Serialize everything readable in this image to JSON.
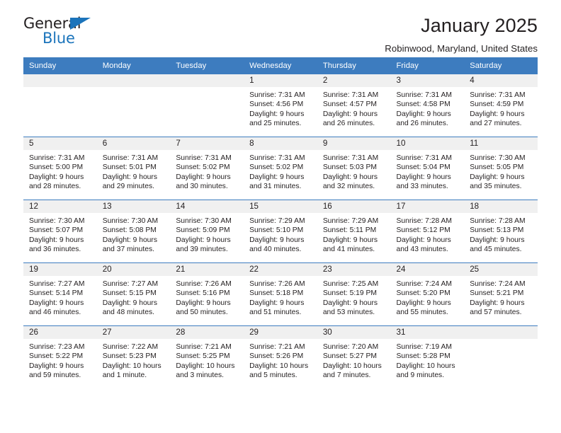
{
  "brand": {
    "name_part1": "General",
    "name_part2": "Blue",
    "triangle_color": "#1b74bb"
  },
  "header": {
    "month_title": "January 2025",
    "location": "Robinwood, Maryland, United States"
  },
  "theme": {
    "header_blue": "#3d7cbf",
    "daynum_bg": "#f0f0f0",
    "text": "#231f20"
  },
  "calendar": {
    "weekday_headers": [
      "Sunday",
      "Monday",
      "Tuesday",
      "Wednesday",
      "Thursday",
      "Friday",
      "Saturday"
    ],
    "weeks": [
      [
        {
          "day": "",
          "sunrise": "",
          "sunset": "",
          "daylight_line1": "",
          "daylight_line2": ""
        },
        {
          "day": "",
          "sunrise": "",
          "sunset": "",
          "daylight_line1": "",
          "daylight_line2": ""
        },
        {
          "day": "",
          "sunrise": "",
          "sunset": "",
          "daylight_line1": "",
          "daylight_line2": ""
        },
        {
          "day": "1",
          "sunrise": "Sunrise: 7:31 AM",
          "sunset": "Sunset: 4:56 PM",
          "daylight_line1": "Daylight: 9 hours",
          "daylight_line2": "and 25 minutes."
        },
        {
          "day": "2",
          "sunrise": "Sunrise: 7:31 AM",
          "sunset": "Sunset: 4:57 PM",
          "daylight_line1": "Daylight: 9 hours",
          "daylight_line2": "and 26 minutes."
        },
        {
          "day": "3",
          "sunrise": "Sunrise: 7:31 AM",
          "sunset": "Sunset: 4:58 PM",
          "daylight_line1": "Daylight: 9 hours",
          "daylight_line2": "and 26 minutes."
        },
        {
          "day": "4",
          "sunrise": "Sunrise: 7:31 AM",
          "sunset": "Sunset: 4:59 PM",
          "daylight_line1": "Daylight: 9 hours",
          "daylight_line2": "and 27 minutes."
        }
      ],
      [
        {
          "day": "5",
          "sunrise": "Sunrise: 7:31 AM",
          "sunset": "Sunset: 5:00 PM",
          "daylight_line1": "Daylight: 9 hours",
          "daylight_line2": "and 28 minutes."
        },
        {
          "day": "6",
          "sunrise": "Sunrise: 7:31 AM",
          "sunset": "Sunset: 5:01 PM",
          "daylight_line1": "Daylight: 9 hours",
          "daylight_line2": "and 29 minutes."
        },
        {
          "day": "7",
          "sunrise": "Sunrise: 7:31 AM",
          "sunset": "Sunset: 5:02 PM",
          "daylight_line1": "Daylight: 9 hours",
          "daylight_line2": "and 30 minutes."
        },
        {
          "day": "8",
          "sunrise": "Sunrise: 7:31 AM",
          "sunset": "Sunset: 5:02 PM",
          "daylight_line1": "Daylight: 9 hours",
          "daylight_line2": "and 31 minutes."
        },
        {
          "day": "9",
          "sunrise": "Sunrise: 7:31 AM",
          "sunset": "Sunset: 5:03 PM",
          "daylight_line1": "Daylight: 9 hours",
          "daylight_line2": "and 32 minutes."
        },
        {
          "day": "10",
          "sunrise": "Sunrise: 7:31 AM",
          "sunset": "Sunset: 5:04 PM",
          "daylight_line1": "Daylight: 9 hours",
          "daylight_line2": "and 33 minutes."
        },
        {
          "day": "11",
          "sunrise": "Sunrise: 7:30 AM",
          "sunset": "Sunset: 5:05 PM",
          "daylight_line1": "Daylight: 9 hours",
          "daylight_line2": "and 35 minutes."
        }
      ],
      [
        {
          "day": "12",
          "sunrise": "Sunrise: 7:30 AM",
          "sunset": "Sunset: 5:07 PM",
          "daylight_line1": "Daylight: 9 hours",
          "daylight_line2": "and 36 minutes."
        },
        {
          "day": "13",
          "sunrise": "Sunrise: 7:30 AM",
          "sunset": "Sunset: 5:08 PM",
          "daylight_line1": "Daylight: 9 hours",
          "daylight_line2": "and 37 minutes."
        },
        {
          "day": "14",
          "sunrise": "Sunrise: 7:30 AM",
          "sunset": "Sunset: 5:09 PM",
          "daylight_line1": "Daylight: 9 hours",
          "daylight_line2": "and 39 minutes."
        },
        {
          "day": "15",
          "sunrise": "Sunrise: 7:29 AM",
          "sunset": "Sunset: 5:10 PM",
          "daylight_line1": "Daylight: 9 hours",
          "daylight_line2": "and 40 minutes."
        },
        {
          "day": "16",
          "sunrise": "Sunrise: 7:29 AM",
          "sunset": "Sunset: 5:11 PM",
          "daylight_line1": "Daylight: 9 hours",
          "daylight_line2": "and 41 minutes."
        },
        {
          "day": "17",
          "sunrise": "Sunrise: 7:28 AM",
          "sunset": "Sunset: 5:12 PM",
          "daylight_line1": "Daylight: 9 hours",
          "daylight_line2": "and 43 minutes."
        },
        {
          "day": "18",
          "sunrise": "Sunrise: 7:28 AM",
          "sunset": "Sunset: 5:13 PM",
          "daylight_line1": "Daylight: 9 hours",
          "daylight_line2": "and 45 minutes."
        }
      ],
      [
        {
          "day": "19",
          "sunrise": "Sunrise: 7:27 AM",
          "sunset": "Sunset: 5:14 PM",
          "daylight_line1": "Daylight: 9 hours",
          "daylight_line2": "and 46 minutes."
        },
        {
          "day": "20",
          "sunrise": "Sunrise: 7:27 AM",
          "sunset": "Sunset: 5:15 PM",
          "daylight_line1": "Daylight: 9 hours",
          "daylight_line2": "and 48 minutes."
        },
        {
          "day": "21",
          "sunrise": "Sunrise: 7:26 AM",
          "sunset": "Sunset: 5:16 PM",
          "daylight_line1": "Daylight: 9 hours",
          "daylight_line2": "and 50 minutes."
        },
        {
          "day": "22",
          "sunrise": "Sunrise: 7:26 AM",
          "sunset": "Sunset: 5:18 PM",
          "daylight_line1": "Daylight: 9 hours",
          "daylight_line2": "and 51 minutes."
        },
        {
          "day": "23",
          "sunrise": "Sunrise: 7:25 AM",
          "sunset": "Sunset: 5:19 PM",
          "daylight_line1": "Daylight: 9 hours",
          "daylight_line2": "and 53 minutes."
        },
        {
          "day": "24",
          "sunrise": "Sunrise: 7:24 AM",
          "sunset": "Sunset: 5:20 PM",
          "daylight_line1": "Daylight: 9 hours",
          "daylight_line2": "and 55 minutes."
        },
        {
          "day": "25",
          "sunrise": "Sunrise: 7:24 AM",
          "sunset": "Sunset: 5:21 PM",
          "daylight_line1": "Daylight: 9 hours",
          "daylight_line2": "and 57 minutes."
        }
      ],
      [
        {
          "day": "26",
          "sunrise": "Sunrise: 7:23 AM",
          "sunset": "Sunset: 5:22 PM",
          "daylight_line1": "Daylight: 9 hours",
          "daylight_line2": "and 59 minutes."
        },
        {
          "day": "27",
          "sunrise": "Sunrise: 7:22 AM",
          "sunset": "Sunset: 5:23 PM",
          "daylight_line1": "Daylight: 10 hours",
          "daylight_line2": "and 1 minute."
        },
        {
          "day": "28",
          "sunrise": "Sunrise: 7:21 AM",
          "sunset": "Sunset: 5:25 PM",
          "daylight_line1": "Daylight: 10 hours",
          "daylight_line2": "and 3 minutes."
        },
        {
          "day": "29",
          "sunrise": "Sunrise: 7:21 AM",
          "sunset": "Sunset: 5:26 PM",
          "daylight_line1": "Daylight: 10 hours",
          "daylight_line2": "and 5 minutes."
        },
        {
          "day": "30",
          "sunrise": "Sunrise: 7:20 AM",
          "sunset": "Sunset: 5:27 PM",
          "daylight_line1": "Daylight: 10 hours",
          "daylight_line2": "and 7 minutes."
        },
        {
          "day": "31",
          "sunrise": "Sunrise: 7:19 AM",
          "sunset": "Sunset: 5:28 PM",
          "daylight_line1": "Daylight: 10 hours",
          "daylight_line2": "and 9 minutes."
        },
        {
          "day": "",
          "sunrise": "",
          "sunset": "",
          "daylight_line1": "",
          "daylight_line2": ""
        }
      ]
    ]
  }
}
